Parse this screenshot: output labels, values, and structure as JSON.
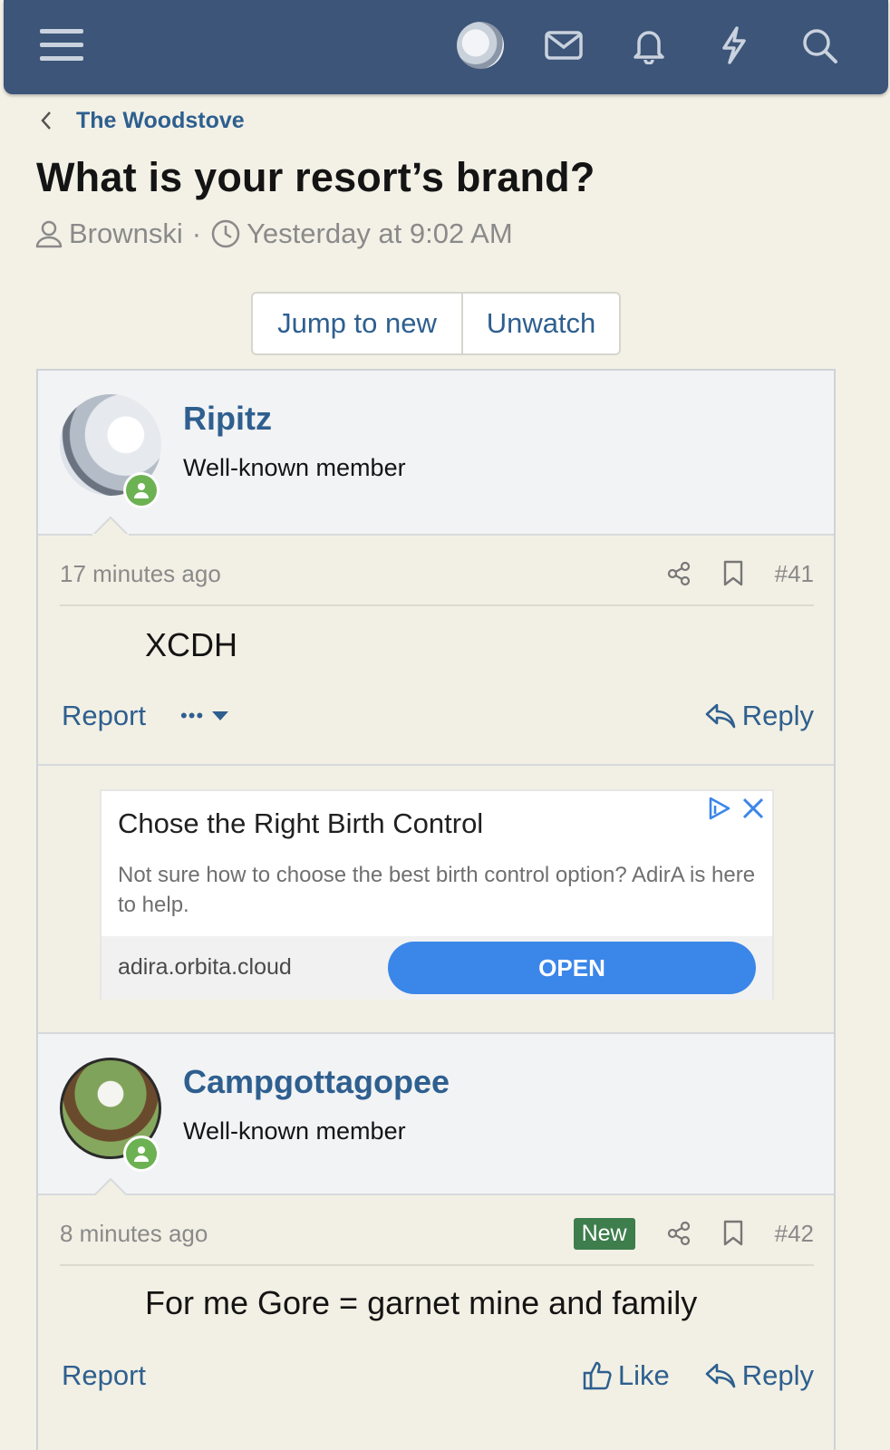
{
  "nav": {
    "icons": [
      "menu-icon",
      "user-avatar",
      "mail-icon",
      "bell-icon",
      "bolt-icon",
      "search-icon"
    ]
  },
  "breadcrumb": {
    "label": "The Woodstove"
  },
  "thread": {
    "title": "What is your resort’s brand?",
    "author": "Brownski",
    "separator": "·",
    "date": "Yesterday at 9:02 AM"
  },
  "buttons": {
    "jump": "Jump to new",
    "unwatch": "Unwatch"
  },
  "posts": [
    {
      "username": "Ripitz",
      "user_title": "Well-known member",
      "time": "17 minutes ago",
      "number": "#41",
      "body": "XCDH",
      "report": "Report",
      "more": "•••",
      "reply": "Reply"
    },
    {
      "username": "Campgottagopee",
      "user_title": "Well-known member",
      "time": "8 minutes ago",
      "badge": "New",
      "number": "#42",
      "body": "For me Gore = garnet mine and family",
      "report": "Report",
      "like": "Like",
      "reply": "Reply"
    }
  ],
  "ad": {
    "title": "Chose the Right Birth Control",
    "text": "Not sure how to choose the best birth control option? AdirA is here to help.",
    "domain": "adira.orbita.cloud",
    "cta": "OPEN"
  },
  "colors": {
    "nav_bg": "#3c5578",
    "link": "#2e5f8f",
    "page_bg": "#f3f1e6",
    "online": "#6cb253",
    "new_badge": "#3e7d4c",
    "ad_button": "#3b86e9"
  }
}
